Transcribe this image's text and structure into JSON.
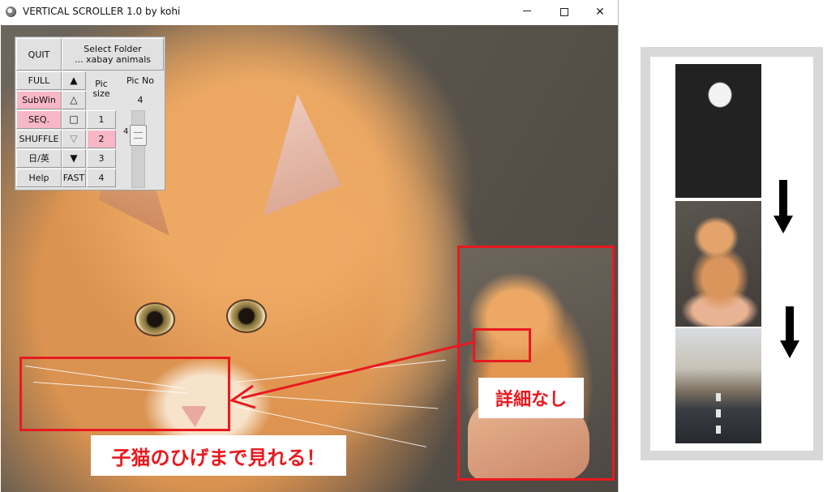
{
  "window": {
    "title": "VERTICAL SCROLLER 1.0 by kohi",
    "icon": "app-icon",
    "controls": [
      "minimize-icon",
      "maximize-icon",
      "close-icon"
    ],
    "close_glyph": "✕"
  },
  "panel": {
    "quit": "QUIT",
    "select_folder_line1": "Select Folder",
    "select_folder_line2": "... xabay animals",
    "full": "FULL",
    "subwin": "SubWin",
    "seq": "SEQ.",
    "shuffle": "SHUFFLE",
    "lang": "日/英",
    "help": "Help",
    "fast": "FAST",
    "up_filled": "▲",
    "up_outline": "△",
    "square": "□",
    "down_outline": "▽",
    "down_filled": "▼",
    "pic_size_label_1": "Pic",
    "pic_size_label_2": "size",
    "sizes": [
      "1",
      "2",
      "3",
      "4"
    ],
    "selected_size": "2",
    "pic_no_label": "Pic No",
    "pic_no_value": "4",
    "slider_value": "4",
    "accent_pink": "#f7b7c6"
  },
  "annotations": {
    "caption_detail": "子猫のひげまで見れる！",
    "caption_no_detail": "詳細なし",
    "highlight_color": "#e8191f"
  }
}
